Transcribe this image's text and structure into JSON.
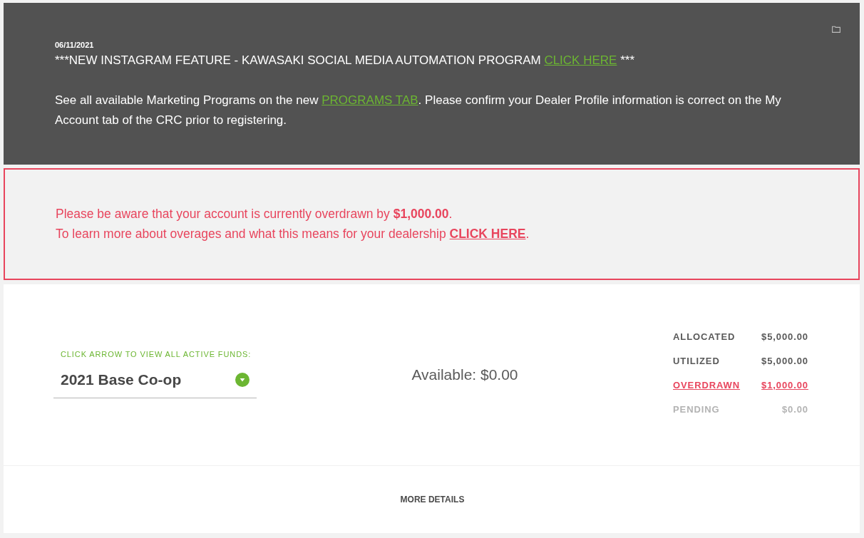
{
  "announcement": {
    "date": "06/11/2021",
    "headline": {
      "before": "***NEW INSTAGRAM FEATURE - KAWASAKI SOCIAL MEDIA AUTOMATION PROGRAM ",
      "link": "CLICK HERE",
      "after": " ***"
    },
    "message": {
      "before": "See all available Marketing Programs on the new ",
      "link": "PROGRAMS TAB",
      "after": ". Please confirm your Dealer Profile information is correct on the My Account tab of the CRC prior to registering."
    }
  },
  "alert": {
    "lines": [
      {
        "text": "Please be aware that your account is currently overdrawn by **$1,000.00**."
      },
      {
        "text": "To learn more about overages and what this means for your dealership ",
        "link": "CLICK HERE",
        "after": "."
      }
    ]
  },
  "funds": {
    "label": "CLICK ARROW TO VIEW ALL ACTIVE FUNDS:",
    "selected_fund": "2021 Base Co-op",
    "available": "Available: $0.00"
  },
  "summary": [
    {
      "label": "ALLOCATED",
      "value": "$5,000.00",
      "kind": "normal"
    },
    {
      "label": "UTILIZED",
      "value": "$5,000.00",
      "kind": "normal"
    },
    {
      "label": "OVERDRAWN",
      "value": "$1,000.00",
      "kind": "overdrawn"
    },
    {
      "label": "PENDING",
      "value": "$0.00",
      "kind": "pending"
    }
  ],
  "footer": {
    "button": "MORE DETAILS"
  }
}
